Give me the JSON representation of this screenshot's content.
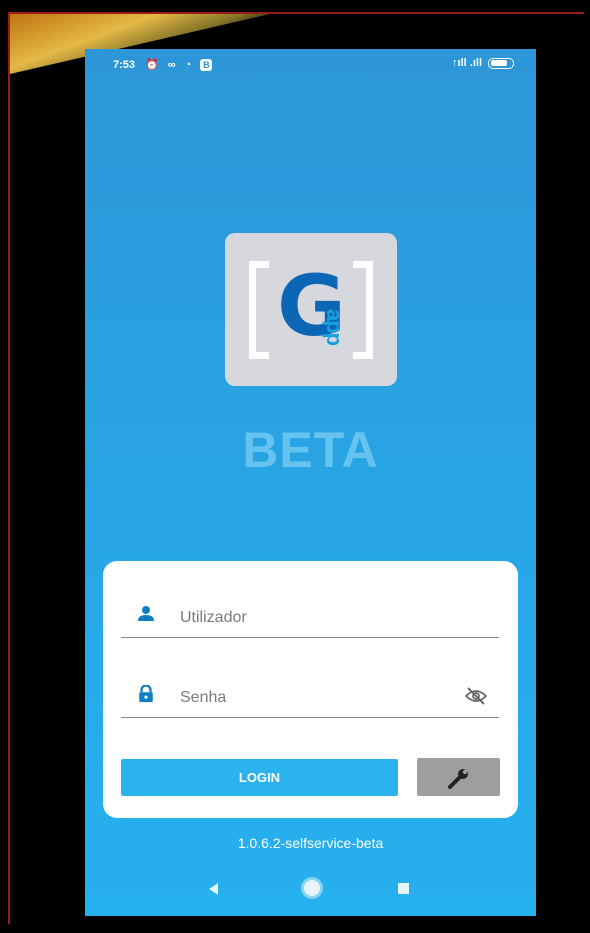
{
  "status_bar": {
    "time": "7:53",
    "left_icons": "⏰ ∞ ◔",
    "badge": "B",
    "right_icons": "↑ıll .ıll"
  },
  "logo": {
    "letter": "G",
    "sub_text": "app"
  },
  "beta_label": "BETA",
  "login_form": {
    "username_placeholder": "Utilizador",
    "password_placeholder": "Senha",
    "login_button": "LOGIN"
  },
  "version": "1.0.6.2-selfservice-beta",
  "colors": {
    "background_top": "#2d96d8",
    "background_bottom": "#27b0ee",
    "accent": "#2bb3ef",
    "logo_blue": "#0b67b5",
    "settings_button": "#9e9e9e"
  },
  "icons": {
    "username": "user-icon",
    "password": "lock-icon",
    "toggle_visibility": "eye-off-icon",
    "settings": "wrench-icon"
  }
}
